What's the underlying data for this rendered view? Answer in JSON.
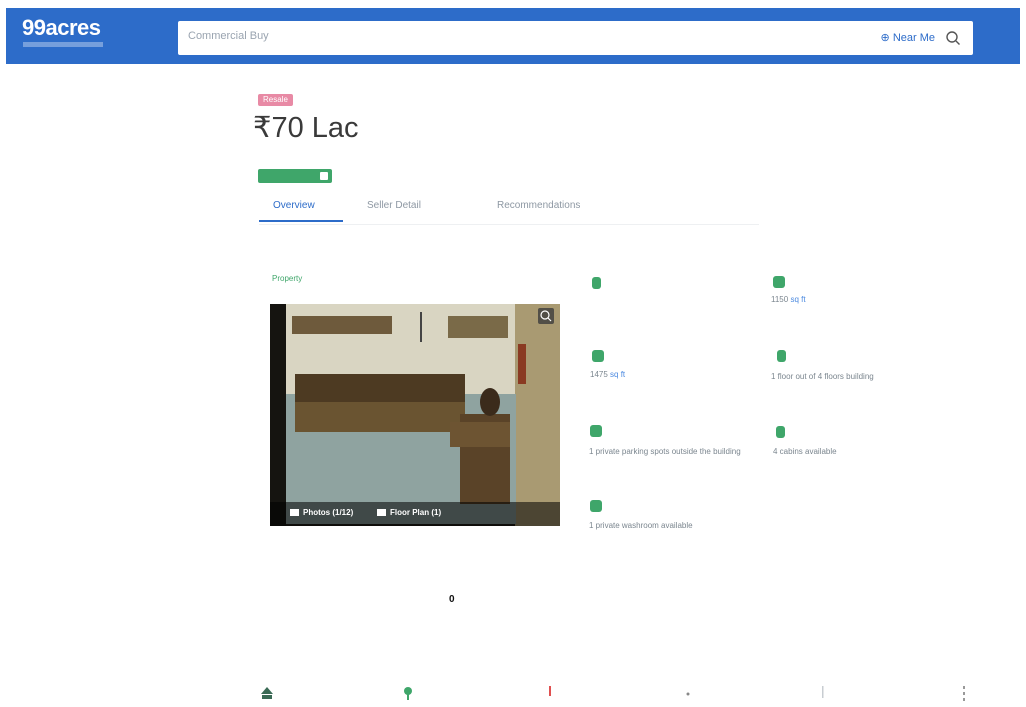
{
  "header": {
    "logo": "99acres",
    "search_placeholder": "Commercial Buy",
    "near_me": "Near Me"
  },
  "top_right_link": "",
  "listing": {
    "badge": "Resale",
    "price": "₹70 Lac",
    "verified_badge": "",
    "verified_sub": ""
  },
  "tabs": [
    {
      "label": "Overview"
    },
    {
      "label": "Seller Detail"
    },
    {
      "label": "Recommendations"
    }
  ],
  "photo": {
    "label": "Property",
    "photos_label": "Photos (1/12)",
    "floorplan_label": "Floor Plan (1)"
  },
  "details": [
    {
      "value": ""
    },
    {
      "value": "1150",
      "unit": "sq ft"
    },
    {
      "value": "1475",
      "unit": "sq ft"
    },
    {
      "value": "1 floor out of 4 floors building"
    },
    {
      "value": "1 private parking spots outside the building"
    },
    {
      "value": "4 cabins available"
    },
    {
      "value": "1 private washroom available"
    }
  ],
  "stats": [
    {
      "label": "",
      "value": "0"
    },
    {
      "label": "",
      "value": ""
    }
  ],
  "section_title": "",
  "colors": {
    "brand": "#2d6cc9",
    "accent": "#3fa66a",
    "badge": "#e88aa5"
  }
}
